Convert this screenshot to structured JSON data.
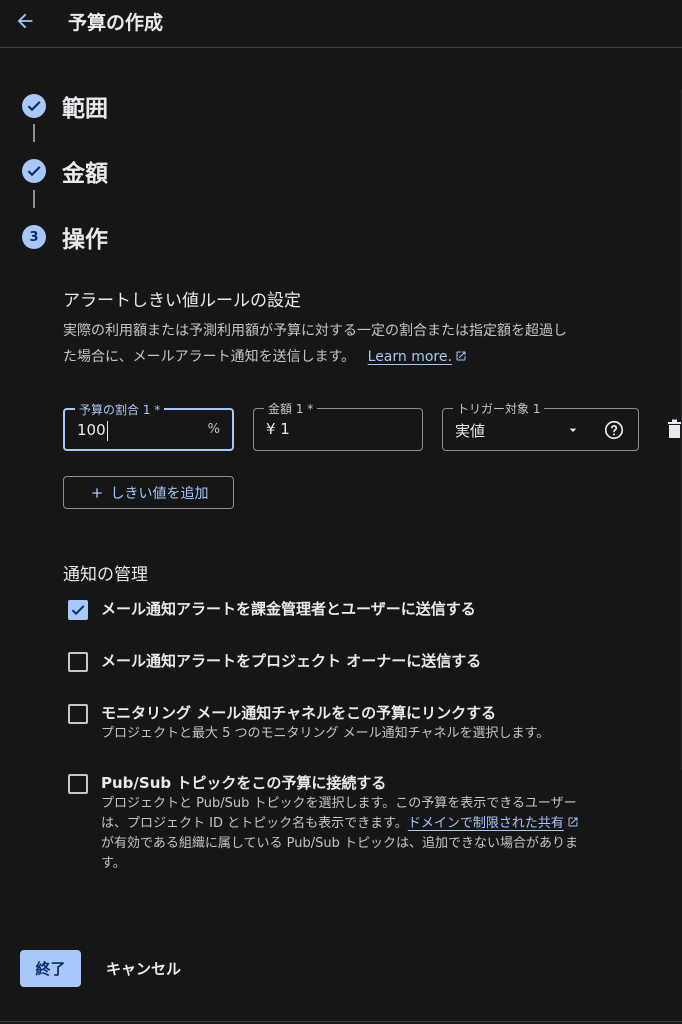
{
  "header": {
    "title": "予算の作成"
  },
  "steps": [
    {
      "label": "範囲",
      "status": "done"
    },
    {
      "label": "金額",
      "status": "done"
    },
    {
      "label": "操作",
      "number": "3",
      "status": "active"
    }
  ],
  "alert": {
    "title": "アラートしきい値ルールの設定",
    "description_line1": "実際の利用額または予測利用額が予算に対する一定の割合または指定額を超過し",
    "description_line2": "た場合に、メールアラート通知を送信します。",
    "learn_more": "Learn more."
  },
  "threshold": {
    "percent_label": "予算の割合 1 *",
    "percent_value": "100",
    "percent_suffix": "%",
    "amount_label": "金額 1 *",
    "amount_value": "¥ 1",
    "trigger_label": "トリガー対象 1",
    "trigger_value": "実値",
    "add_label": "しきい値を追加"
  },
  "notifications": {
    "title": "通知の管理",
    "items": [
      {
        "label": "メール通知アラートを課金管理者とユーザーに送信する",
        "checked": true
      },
      {
        "label": "メール通知アラートをプロジェクト オーナーに送信する",
        "checked": false
      },
      {
        "label": "モニタリング メール通知チャネルをこの予算にリンクする",
        "checked": false,
        "sub": "プロジェクトと最大 5 つのモニタリング メール通知チャネルを選択します。"
      },
      {
        "label": "Pub/Sub トピックをこの予算に接続する",
        "checked": false,
        "sub_line1": "プロジェクトと Pub/Sub トピックを選択します。この予算を表示できるユーザー",
        "sub_line2_a": "は、プロジェクト ID とトピック名も表示できます。",
        "sub_link": "ドメインで制限された共有",
        "sub_line3": "が有効である組織に属している Pub/Sub トピックは、追加できない場合がありま",
        "sub_line4": "す。"
      }
    ]
  },
  "footer": {
    "done": "終了",
    "cancel": "キャンセル"
  },
  "colors": {
    "accent": "#a8c7fa",
    "background": "#161616",
    "text": "#e8eaed"
  }
}
